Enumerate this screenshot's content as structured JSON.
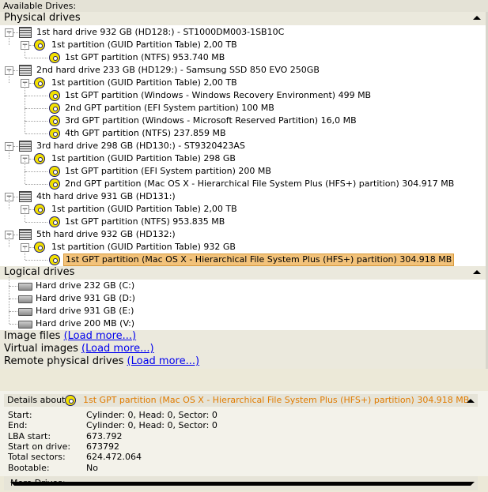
{
  "header": {
    "title": "Available Drives:"
  },
  "physical": {
    "title": "Physical drives",
    "drives": [
      {
        "label": "1st hard drive 932 GB (HD128:) - ST1000DM003-1SB10C",
        "table": "1st partition (GUID Partition Table) 2,00 TB",
        "parts": [
          "1st GPT partition (NTFS) 953.740 MB"
        ]
      },
      {
        "label": "2nd hard drive 233 GB (HD129:) - Samsung SSD 850 EVO 250GB",
        "table": "1st partition (GUID Partition Table) 2,00 TB",
        "parts": [
          "1st GPT partition (Windows - Windows Recovery Environment) 499 MB",
          "2nd GPT partition (EFI System partition) 100 MB",
          "3rd GPT partition (Windows - Microsoft Reserved Partition) 16,0 MB",
          "4th GPT partition (NTFS) 237.859 MB"
        ]
      },
      {
        "label": "3rd hard drive 298 GB (HD130:) - ST9320423AS",
        "table": "1st partition (GUID Partition Table) 298 GB",
        "parts": [
          "1st GPT partition (EFI System partition) 200 MB",
          "2nd GPT partition (Mac OS X - Hierarchical File System Plus (HFS+) partition) 304.917 MB"
        ]
      },
      {
        "label": "4th hard drive 931 GB (HD131:)",
        "table": "1st partition (GUID Partition Table) 2,00 TB",
        "parts": [
          "1st GPT partition (NTFS) 953.835 MB"
        ]
      },
      {
        "label": "5th hard drive 932 GB (HD132:)",
        "table": "1st partition (GUID Partition Table) 932 GB",
        "parts": [
          "1st GPT partition (Mac OS X - Hierarchical File System Plus (HFS+) partition) 304.918 MB"
        ]
      }
    ]
  },
  "logical": {
    "title": "Logical drives",
    "items": [
      "Hard drive 232 GB (C:)",
      "Hard drive 931 GB (D:)",
      "Hard drive 931 GB (E:)",
      "Hard drive 200 MB (V:)"
    ]
  },
  "extras": [
    {
      "label": "Image files",
      "link": "(Load more...)"
    },
    {
      "label": "Virtual images",
      "link": "(Load more...)"
    },
    {
      "label": "Remote physical drives",
      "link": "(Load more...)"
    }
  ],
  "details": {
    "label": "Details about:",
    "selected": "1st GPT partition (Mac OS X - Hierarchical File System Plus (HFS+) partition) 304.918 MB",
    "rows": [
      {
        "k": "Start:",
        "v": "Cylinder: 0, Head: 0, Sector: 0"
      },
      {
        "k": "End:",
        "v": "Cylinder: 0, Head: 0, Sector: 0"
      },
      {
        "k": "LBA start:",
        "v": "673.792"
      },
      {
        "k": "Start on drive:",
        "v": "673792"
      },
      {
        "k": "Total sectors:",
        "v": "624.472.064"
      },
      {
        "k": "Bootable:",
        "v": "No"
      }
    ]
  },
  "more": {
    "label": "More Drives:"
  },
  "colors": {
    "selection": "#f2c27a",
    "accent_text": "#e07b00",
    "link": "#0000ee"
  }
}
